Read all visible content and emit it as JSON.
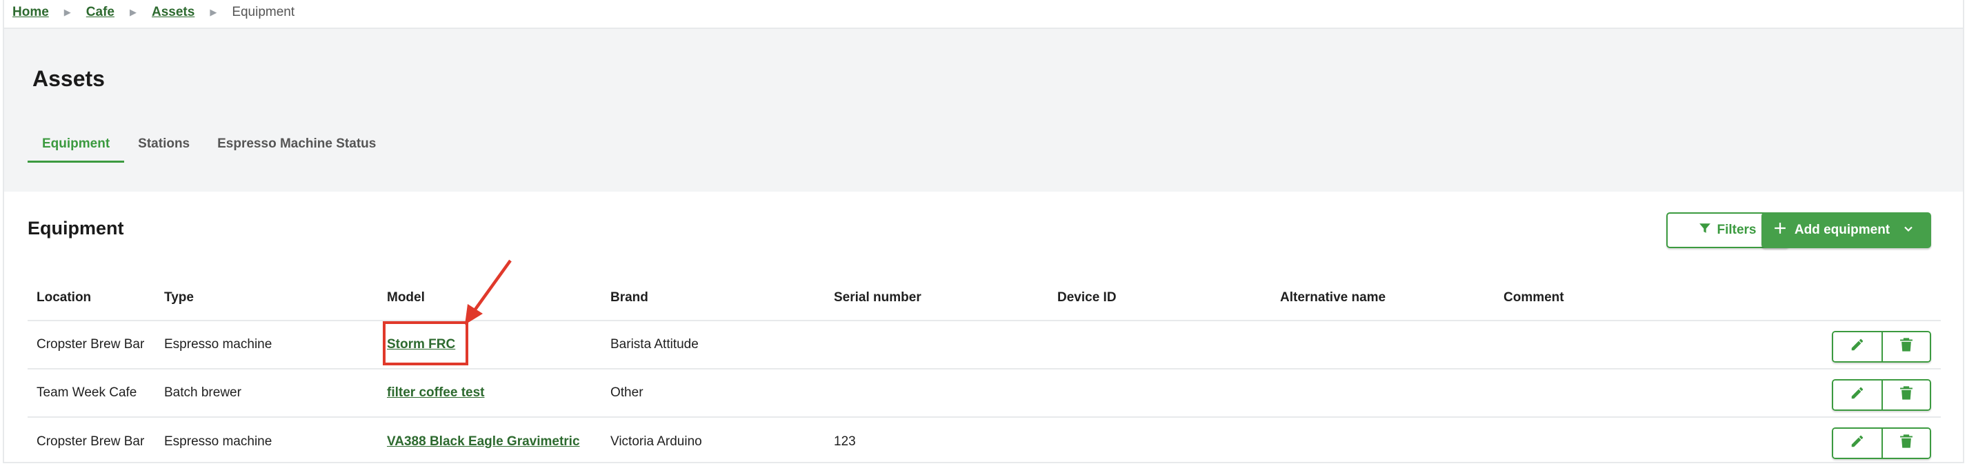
{
  "breadcrumb": {
    "items": [
      "Home",
      "Cafe",
      "Assets"
    ],
    "current": "Equipment"
  },
  "page": {
    "title": "Assets",
    "tabs": [
      {
        "label": "Equipment",
        "active": true
      },
      {
        "label": "Stations",
        "active": false
      },
      {
        "label": "Espresso Machine Status",
        "active": false
      }
    ]
  },
  "section": {
    "title": "Equipment",
    "filters_label": "Filters",
    "add_label": "Add equipment"
  },
  "table": {
    "headers": [
      "Location",
      "Type",
      "Model",
      "Brand",
      "Serial number",
      "Device ID",
      "Alternative name",
      "Comment"
    ],
    "rows": [
      {
        "location": "Cropster Brew Bar",
        "type": "Espresso machine",
        "model": "Storm FRC",
        "brand": "Barista Attitude",
        "serial": "",
        "device_id": "",
        "alt_name": "",
        "comment": ""
      },
      {
        "location": "Team Week Cafe",
        "type": "Batch brewer",
        "model": "filter coffee test",
        "brand": "Other",
        "serial": "",
        "device_id": "",
        "alt_name": "",
        "comment": ""
      },
      {
        "location": "Cropster Brew Bar",
        "type": "Espresso machine",
        "model": "VA388 Black Eagle Gravimetric",
        "brand": "Victoria Arduino",
        "serial": "123",
        "device_id": "",
        "alt_name": "",
        "comment": ""
      }
    ]
  },
  "icons": {
    "filter": "filter-icon",
    "plus": "plus-icon",
    "chevron": "chevron-down-icon",
    "edit": "pencil-icon",
    "delete": "trash-icon"
  },
  "colors": {
    "accent": "#3b9a3f",
    "link": "#2d6a2f",
    "annotation": "#e0392b"
  }
}
